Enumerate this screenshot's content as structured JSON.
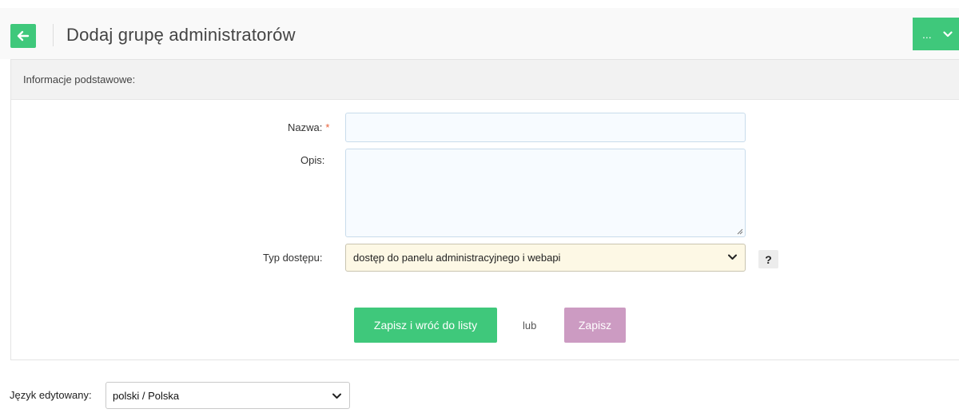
{
  "header": {
    "title": "Dodaj grupę administratorów",
    "more_label": "...",
    "back_icon": "arrow-left-icon"
  },
  "panel": {
    "heading": "Informacje podstawowe:"
  },
  "form": {
    "name_label": "Nazwa:",
    "required_mark": "*",
    "name_value": "",
    "description_label": "Opis:",
    "description_value": "",
    "access_type_label": "Typ dostępu:",
    "access_type_value": "dostęp do panelu administracyjnego i webapi",
    "help_label": "?"
  },
  "actions": {
    "save_and_return_label": "Zapisz i wróć do listy",
    "or_label": "lub",
    "save_label": "Zapisz"
  },
  "language": {
    "label": "Język edytowany:",
    "value": "polski / Polska"
  },
  "colors": {
    "primary_green": "#3fc87b",
    "save_pink": "#cc9bc2",
    "required_red": "#e8613b",
    "select_bg": "#fdf8e5"
  }
}
